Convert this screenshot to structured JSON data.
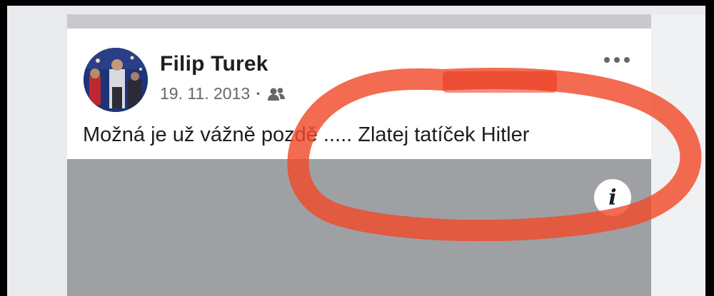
{
  "post": {
    "author": "Filip Turek",
    "date": "19. 11. 2013",
    "separator": "·",
    "audience_icon": "friends-icon",
    "text": "Možná je už vážně pozdě ..... Zlatej tatíček Hitler",
    "more_icon": "more-options-icon",
    "media_info_icon": "info-icon",
    "media_info_glyph": "i"
  },
  "annotation": {
    "type": "hand-drawn circle",
    "color": "#f04a2a",
    "target": "Zlatej tatíček Hitler"
  }
}
